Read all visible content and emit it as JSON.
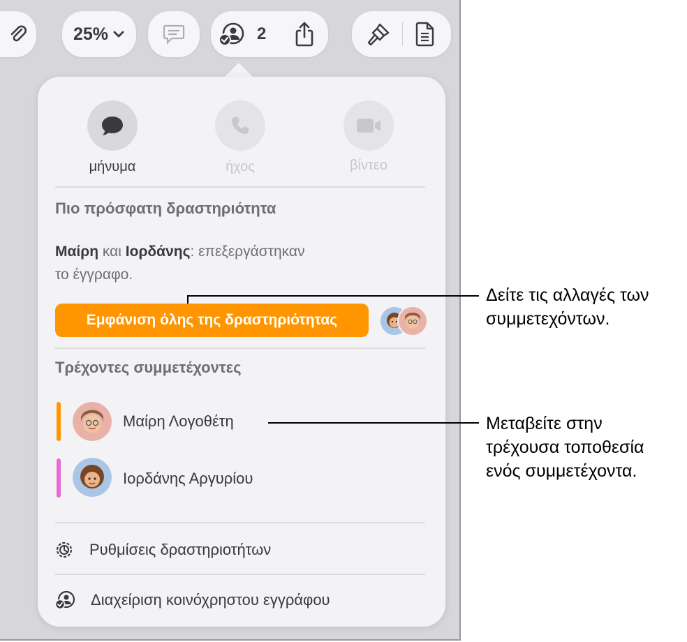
{
  "toolbar": {
    "zoom_label": "25%",
    "collab_count": "2",
    "icons": [
      "paperclip-icon",
      "chevron-down-icon",
      "comment-icon",
      "collaboration-icon",
      "share-icon",
      "paintbrush-icon",
      "document-icon"
    ]
  },
  "popover": {
    "comm": {
      "message_label": "μήνυμα",
      "audio_label": "ήχος",
      "video_label": "βίντεο"
    },
    "recent": {
      "title": "Πιο πρόσφατη δραστηριότητα",
      "name1": "Μαίρη",
      "and": " και ",
      "name2": "Ιορδάνης",
      "rest_line1": ": επεξεργάστηκαν",
      "line2": "το έγγραφο.",
      "button_label": "Εμφάνιση όλης της δραστηριότητας"
    },
    "participants": {
      "title": "Τρέχοντες συμμετέχοντες",
      "items": [
        {
          "name": "Μαίρη Λογοθέτη",
          "color": "#ff9500"
        },
        {
          "name": "Ιορδάνης Αργυρίου",
          "color": "#e76ad8"
        }
      ]
    },
    "menu": {
      "activity_settings": "Ρυθμίσεις δραστηριοτήτων",
      "manage_shared": "Διαχείριση κοινόχρηστου εγγράφου"
    }
  },
  "callouts": {
    "changes": "Δείτε τις αλλαγές των\nσυμμετεχόντων.",
    "location": "Μεταβείτε στην\nτρέχουσα τοποθεσία\nενός συμμετέχοντα."
  },
  "colors": {
    "accent": "#ff9500",
    "indicator_pink": "#e76ad8"
  }
}
